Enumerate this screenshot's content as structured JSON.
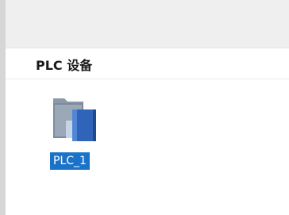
{
  "section": {
    "title": "PLC 设备"
  },
  "devices": [
    {
      "label": "PLC_1",
      "icon": "plc-folder-icon",
      "selected": true
    }
  ],
  "colors": {
    "selection": "#1a73c8",
    "folder_dark": "#6b7a8c",
    "folder_light": "#a6b4c4",
    "book_blue": "#2f64b8"
  }
}
